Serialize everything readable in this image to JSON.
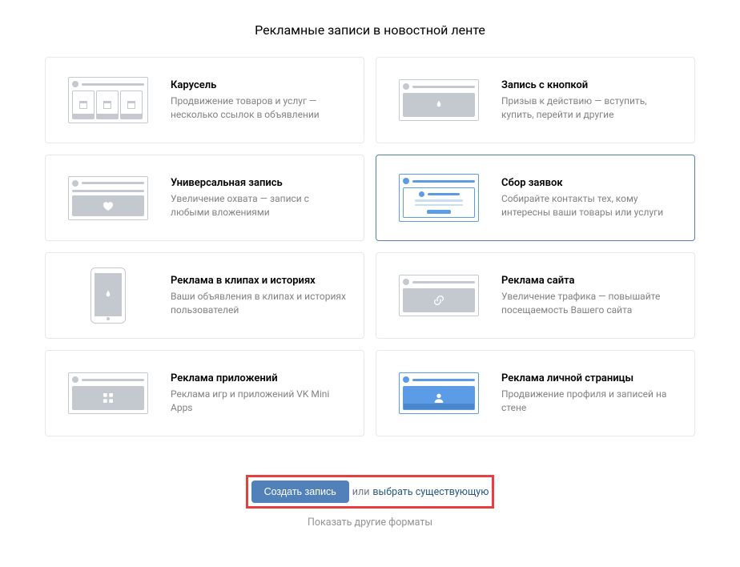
{
  "page": {
    "title": "Рекламные записи в новостной ленте"
  },
  "cards": [
    {
      "title": "Карусель",
      "desc": "Продвижение товаров и услуг — несколько ссылок в объявлении",
      "icon": "carousel"
    },
    {
      "title": "Запись с кнопкой",
      "desc": "Призыв к действию — вступить, купить, перейти и другие",
      "icon": "button-post"
    },
    {
      "title": "Универсальная запись",
      "desc": "Увеличение охвата — записи с любыми вложениями",
      "icon": "universal"
    },
    {
      "title": "Сбор заявок",
      "desc": "Собирайте контакты тех, кому интересны ваши товары или услуги",
      "icon": "leads",
      "selected": true
    },
    {
      "title": "Реклама в клипах и историях",
      "desc": "Ваши объявления в клипах и историях пользователей",
      "icon": "stories"
    },
    {
      "title": "Реклама сайта",
      "desc": "Увеличение трафика — повышайте посещаемость Вашего сайта",
      "icon": "site"
    },
    {
      "title": "Реклама приложений",
      "desc": "Реклама игр и приложений VK Mini Apps",
      "icon": "apps"
    },
    {
      "title": "Реклама личной страницы",
      "desc": "Продвижение профиля и записей на стене",
      "icon": "profile"
    }
  ],
  "bottom": {
    "create_button": "Создать запись",
    "or": "или",
    "choose_existing": "выбрать существующую",
    "show_other": "Показать другие форматы"
  }
}
